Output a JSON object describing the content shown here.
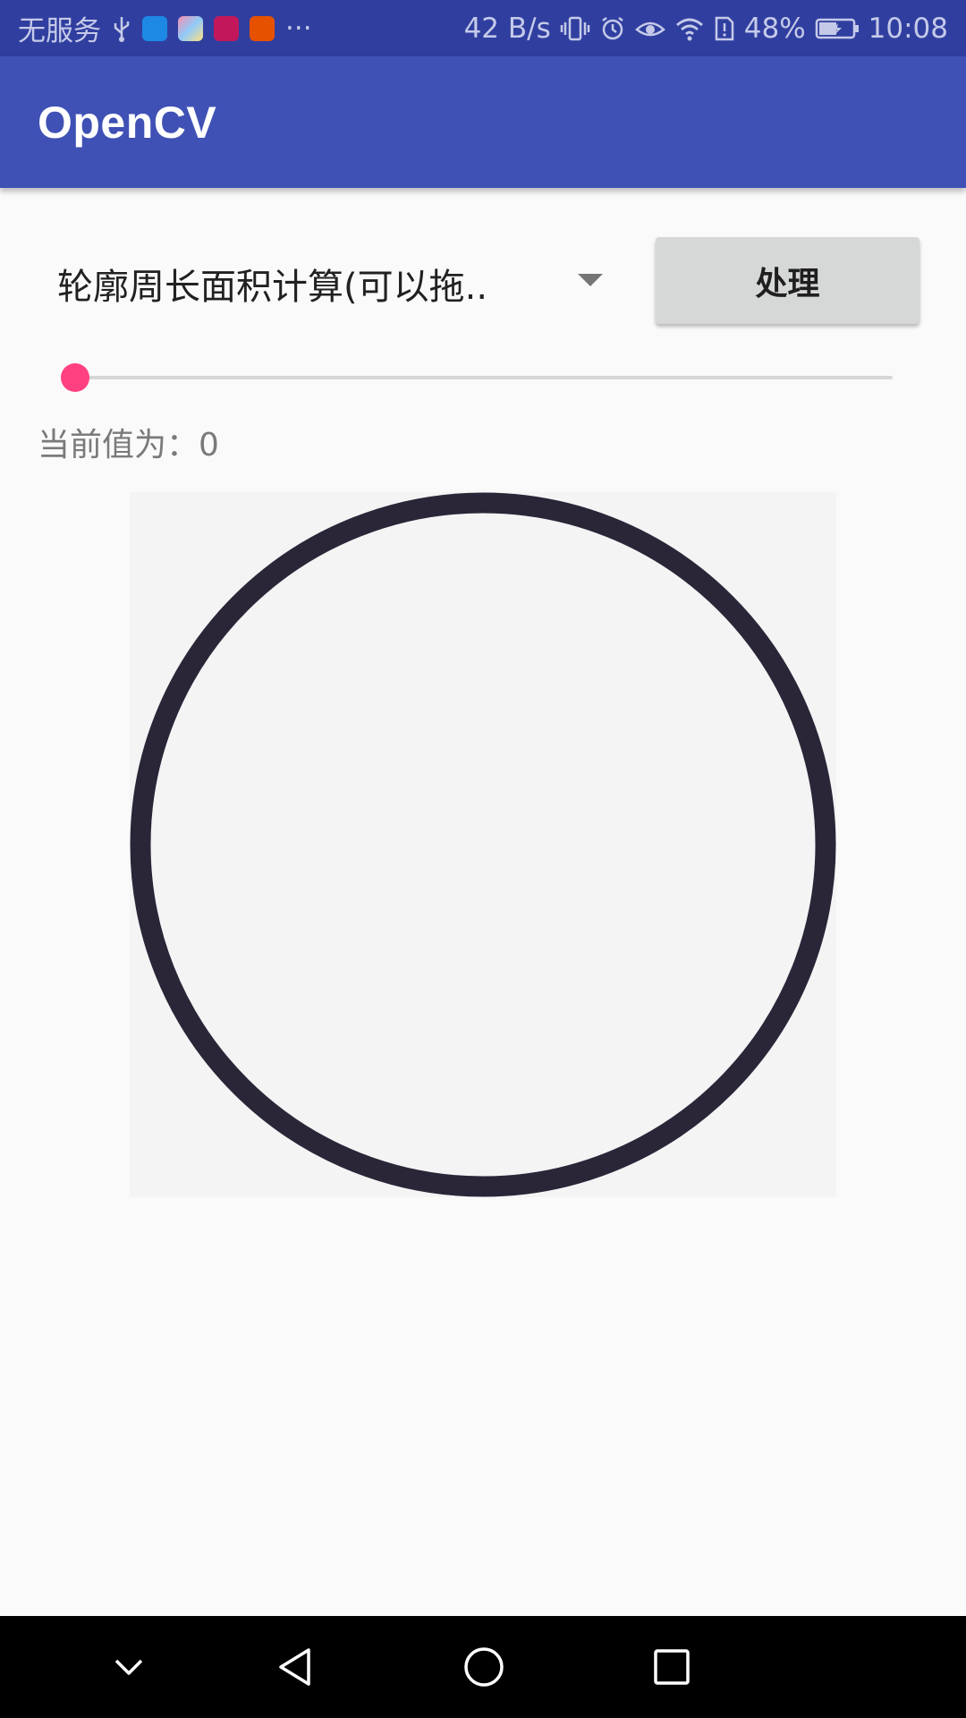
{
  "status_bar": {
    "carrier": "无服务",
    "more": "···",
    "net_speed": "42 B/s",
    "battery": "48%",
    "time": "10:08",
    "icons": [
      "usb-icon",
      "browser-app-icon",
      "gallery-app-icon",
      "huawei-app-icon",
      "video-app-icon",
      "vibrate-icon",
      "alarm-icon",
      "eye-comfort-icon",
      "wifi-icon",
      "sim-alert-icon",
      "battery-charging-icon"
    ]
  },
  "app_bar": {
    "title": "OpenCV"
  },
  "controls": {
    "spinner_value": "轮廓周长面积计算(可以拖..",
    "process_label": "处理",
    "slider_value": 0,
    "value_prefix": "当前值为：",
    "value_text": "0"
  },
  "image": {
    "content": "circle-outline",
    "stroke_color": "#2a2638",
    "background_color": "#f4f4f5"
  },
  "nav_bar": {
    "buttons": [
      "dismiss-chevron-icon",
      "back-icon",
      "home-icon",
      "recents-icon"
    ]
  },
  "colors": {
    "primary": "#3f51b5",
    "primary_dark": "#303f9f",
    "accent": "#ff4081"
  }
}
